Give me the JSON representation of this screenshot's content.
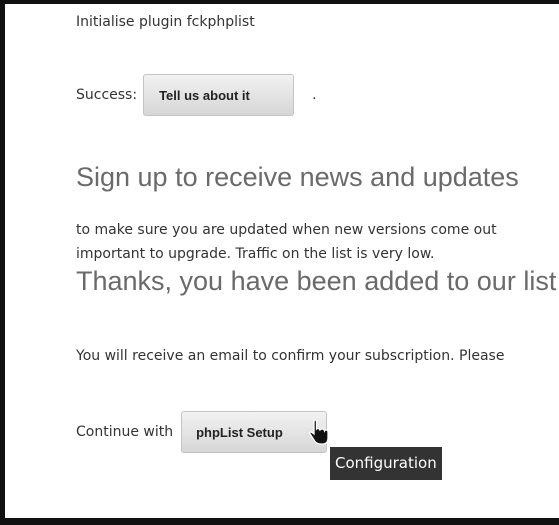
{
  "plugin_init": {
    "text": "Initialise plugin fckphplist"
  },
  "success": {
    "label": "Success:",
    "button_label": "Tell us about it",
    "trailing": "."
  },
  "signup": {
    "heading": "Sign up to receive news and updates",
    "text_line1": "to make sure you are updated when new versions come out",
    "text_line2": "important to upgrade. Traffic on the list is very low."
  },
  "thanks": {
    "heading": "Thanks, you have been added to our list",
    "text": "You will receive an email to confirm your subscription. Please"
  },
  "continue": {
    "label": "Continue with",
    "button_label": "phpList Setup"
  },
  "tooltip": {
    "text": "Configuration"
  }
}
